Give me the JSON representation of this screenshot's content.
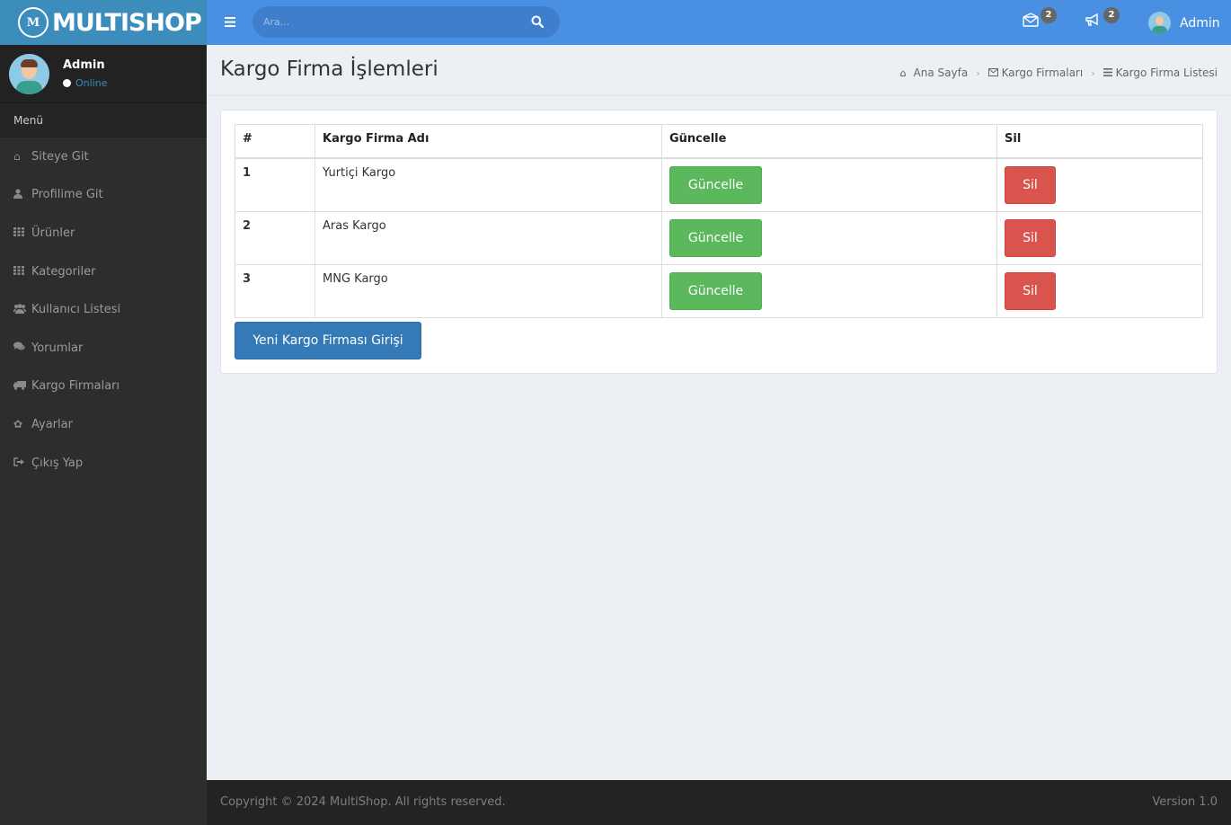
{
  "brand": {
    "name": "MULTISHOP",
    "logo_letter": "M"
  },
  "sidebar": {
    "user": {
      "name": "Admin",
      "status": "Online"
    },
    "menu_header": "Menü",
    "items": [
      {
        "label": "Siteye Git",
        "icon": "home-icon"
      },
      {
        "label": "Profilime Git",
        "icon": "user-icon"
      },
      {
        "label": "Ürünler",
        "icon": "grid-icon"
      },
      {
        "label": "Kategoriler",
        "icon": "grid-icon"
      },
      {
        "label": "Kullanıcı Listesi",
        "icon": "users-icon"
      },
      {
        "label": "Yorumlar",
        "icon": "comments-icon"
      },
      {
        "label": "Kargo Firmaları",
        "icon": "truck-icon"
      },
      {
        "label": "Ayarlar",
        "icon": "gear-icon"
      },
      {
        "label": "Çıkış Yap",
        "icon": "sign-out-icon"
      }
    ]
  },
  "navbar": {
    "search_placeholder": "Ara...",
    "messages_count": "2",
    "notifications_count": "2",
    "user_name": "Admin"
  },
  "header": {
    "title": "Kargo Firma İşlemleri",
    "breadcrumb": [
      "Ana Sayfa",
      "Kargo Firmaları",
      "Kargo Firma Listesi"
    ]
  },
  "table": {
    "columns": [
      "#",
      "Kargo Firma Adı",
      "Güncelle",
      "Sil"
    ],
    "rows": [
      {
        "id": "1",
        "name": "Yurtiçi Kargo",
        "update_label": "Güncelle",
        "delete_label": "Sil"
      },
      {
        "id": "2",
        "name": "Aras Kargo",
        "update_label": "Güncelle",
        "delete_label": "Sil"
      },
      {
        "id": "3",
        "name": "MNG Kargo",
        "update_label": "Güncelle",
        "delete_label": "Sil"
      }
    ]
  },
  "new_button_label": "Yeni Kargo Firması Girişi",
  "footer": {
    "copyright": "Copyright © 2024 MultiShop. All rights reserved.",
    "version": "Version 1.0"
  },
  "colors": {
    "brand_blue": "#3c8dbc",
    "navbar_blue": "#4a90e2",
    "success": "#5cb85c",
    "danger": "#d9534f",
    "primary": "#337ab7",
    "sidebar_bg": "#2d2d2d"
  }
}
